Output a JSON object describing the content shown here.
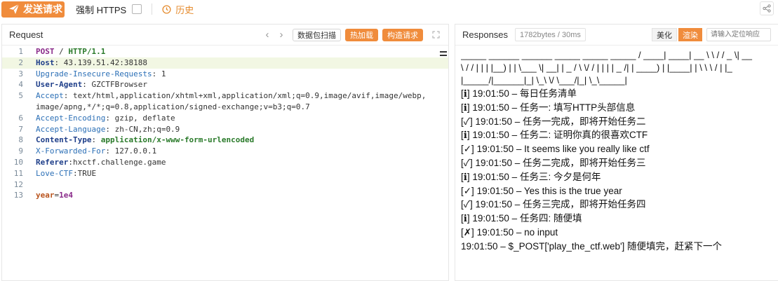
{
  "toolbar": {
    "send_label": "发送请求",
    "force_https_label": "强制 HTTPS",
    "history_label": "历史"
  },
  "request": {
    "title": "Request",
    "scan_label": "数据包扫描",
    "hotload_label": "热加载",
    "construct_label": "构造请求",
    "lines": [
      {
        "n": "1",
        "method": "POST",
        "path": " / ",
        "proto": "HTTP/1.1"
      },
      {
        "n": "2",
        "key": "Host",
        "val": " 43.139.51.42:38188"
      },
      {
        "n": "3",
        "key": "Upgrade-Insecure-Requests",
        "val": " 1"
      },
      {
        "n": "4",
        "key": "User-Agent",
        "val": " GZCTFBrowser"
      },
      {
        "n": "5",
        "key": "Accept",
        "val": " text/html,application/xhtml+xml,application/xml;q=0.9,image/avif,image/webp,"
      },
      {
        "n": "",
        "val": "image/apng,*/*;q=0.8,application/signed-exchange;v=b3;q=0.7"
      },
      {
        "n": "6",
        "key": "Accept-Encoding",
        "val": " gzip, deflate"
      },
      {
        "n": "7",
        "key": "Accept-Language",
        "val": " zh-CN,zh;q=0.9"
      },
      {
        "n": "8",
        "key": "Content-Type",
        "val": " application/x-www-form-urlencoded"
      },
      {
        "n": "9",
        "key": "X-Forwarded-For",
        "val": " 127.0.0.1"
      },
      {
        "n": "10",
        "key": "Referer",
        "val": "hxctf.challenge.game"
      },
      {
        "n": "11",
        "key": "Love-CTF",
        "val": "TRUE"
      },
      {
        "n": "12"
      },
      {
        "n": "13",
        "body_key": "year",
        "body_val": "1e4"
      }
    ]
  },
  "response": {
    "title": "Responses",
    "size": "1782bytes / 30ms",
    "pretty_label": "美化",
    "render_label": "渲染",
    "locate_placeholder": "请输入定位响应",
    "ascii": [
      "_____ ______ ______ _____ _____ _____ / ____| ____| __ \\ \\ / / _ \\| __",
      "\\ / / | | | |__) | | \\___ \\| __| | _ / \\ \\/ / | | | | _ /| | ____) | |____| | \\ \\ \\ / | |_",
      "|_____/|______|_| \\_\\ \\/ \\___/|_| \\_\\_____|"
    ],
    "logs": [
      "[ℹ] 19:01:50 – 每日任务清单",
      "[ℹ] 19:01:50 – 任务一: 填写HTTP头部信息",
      "[✓] 19:01:50 – 任务一完成，即将开始任务二",
      "[ℹ] 19:01:50 – 任务二: 证明你真的很喜欢CTF",
      "[✓] 19:01:50 – It seems like you really like ctf",
      "[✓] 19:01:50 – 任务二完成，即将开始任务三",
      "[ℹ] 19:01:50 – 任务三: 今夕是何年",
      "[✓] 19:01:50 – Yes this is the true year",
      "[✓] 19:01:50 – 任务三完成，即将开始任务四",
      "[ℹ] 19:01:50 – 任务四: 随便填",
      "[✗] 19:01:50 – no input",
      "19:01:50 – $_POST['play_the_ctf.web'] 随便填完，赶紧下一个"
    ]
  },
  "colors": {
    "accent": "#f08c3c",
    "active_line": "#f2f7e3"
  }
}
